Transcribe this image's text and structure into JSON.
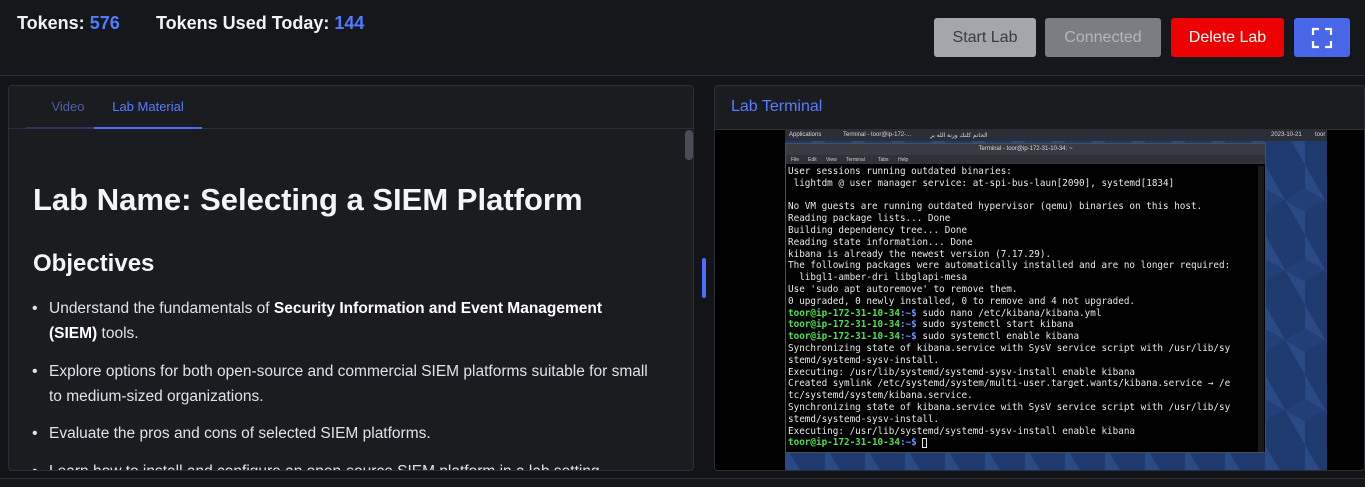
{
  "header": {
    "tokens_label": "Tokens:",
    "tokens_value": "576",
    "tokens_today_label": "Tokens Used Today:",
    "tokens_today_value": "144",
    "start_label": "Start Lab",
    "connected_label": "Connected",
    "delete_label": "Delete Lab"
  },
  "tabs": {
    "video": "Video",
    "lab_material": "Lab Material"
  },
  "lab": {
    "title": "Lab Name: Selecting a SIEM Platform",
    "objectives_heading": "Objectives",
    "obj1_pre": "Understand the fundamentals of ",
    "obj1_bold": "Security Information and Event Management (SIEM)",
    "obj1_post": " tools.",
    "obj2": "Explore options for both open-source and commercial SIEM platforms suitable for small to medium-sized organizations.",
    "obj3": "Evaluate the pros and cons of selected SIEM platforms.",
    "obj4": "Learn how to install and configure an open-source SIEM platform in a lab setting."
  },
  "terminal_panel": {
    "title": "Lab Terminal",
    "topbar_apps": "Applications",
    "topbar_task": "Terminal - toor@ip-172-...",
    "topbar_arabic": "الخاتم كلتك وزنة الله بر",
    "topbar_time": "2023-10-21",
    "topbar_user": "toor",
    "window_title": "Terminal - toor@ip-172-31-10-34: ~",
    "menu": [
      "File",
      "Edit",
      "View",
      "Terminal",
      "Tabs",
      "Help"
    ],
    "prompt": "toor@ip-172-31-10-34",
    "path": ":~$",
    "lines_a": "User sessions running outdated binaries:\n lightdm @ user manager service: at-spi-bus-laun[2090], systemd[1834]\n\nNo VM guests are running outdated hypervisor (qemu) binaries on this host.\nReading package lists... Done\nBuilding dependency tree... Done\nReading state information... Done\nkibana is already the newest version (7.17.29).\nThe following packages were automatically installed and are no longer required:\n  libgl1-amber-dri libglapi-mesa\nUse 'sudo apt autoremove' to remove them.\n0 upgraded, 0 newly installed, 0 to remove and 4 not upgraded.",
    "cmd1": " sudo nano /etc/kibana/kibana.yml",
    "cmd2": " sudo systemctl start kibana",
    "cmd3": " sudo systemctl enable kibana",
    "lines_b": "Synchronizing state of kibana.service with SysV service script with /usr/lib/sy\nstemd/systemd-sysv-install.\nExecuting: /usr/lib/systemd/systemd-sysv-install enable kibana\nCreated symlink /etc/systemd/system/multi-user.target.wants/kibana.service → /e\ntc/systemd/system/kibana.service.\nSynchronizing state of kibana.service with SysV service script with /usr/lib/sy\nstemd/systemd-sysv-install.\nExecuting: /usr/lib/systemd/systemd-sysv-install enable kibana"
  }
}
